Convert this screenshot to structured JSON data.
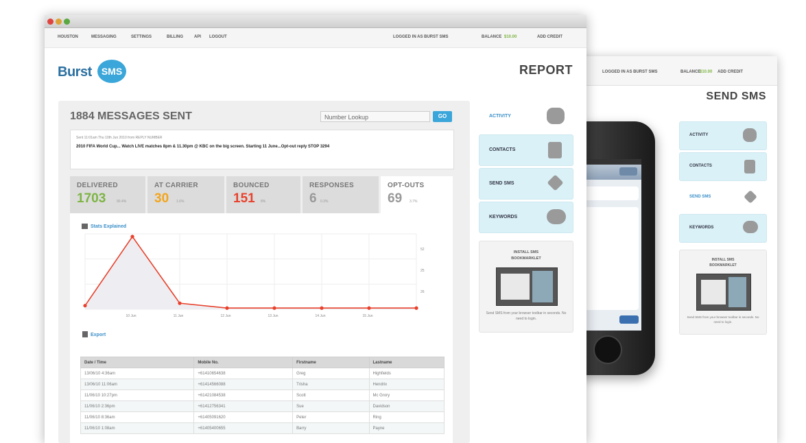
{
  "front_window": {
    "menu": [
      "HOUSTON",
      "MESSAGING",
      "SETTINGS",
      "BILLING",
      "API",
      "LOGOUT"
    ],
    "logged_in": "LOGGED IN AS BURST SMS",
    "balance_label": "BALANCE",
    "balance_value": "$10.00",
    "add_credit": "ADD CREDIT",
    "logo_text": "Burst",
    "logo_badge": "SMS",
    "page_title": "REPORT",
    "messages_sent": "1884 MESSAGES SENT",
    "lookup_placeholder": "Number Lookup",
    "go_label": "GO",
    "message_meta": "Sent 11:01am Thu 10th Jun 2010 from REPLY NUMBER",
    "message_text": "2010 FIFA World Cup... Watch LIVE matches 8pm & 11.30pm @ KBC on the big screen. Starting 11 June...Opt-out reply STOP 3294",
    "stats": [
      {
        "label": "DELIVERED",
        "value": "1703",
        "pct": "90.4%",
        "color": "#7db443"
      },
      {
        "label": "AT CARRIER",
        "value": "30",
        "pct": "1.6%",
        "color": "#f3a51b"
      },
      {
        "label": "BOUNCED",
        "value": "151",
        "pct": "8%",
        "color": "#e8412c"
      },
      {
        "label": "RESPONSES",
        "value": "6",
        "pct": "0.3%",
        "color": "#999999"
      },
      {
        "label": "OPT-OUTS",
        "value": "69",
        "pct": "3.7%",
        "color": "#999999"
      }
    ],
    "stats_link": "Stats Explained",
    "export_link": "Export",
    "table": {
      "headers": [
        "Date / Time",
        "Mobile No.",
        "Firstname",
        "Lastname"
      ],
      "rows": [
        [
          "13/06/10 4:36am",
          "+61410654638",
          "Greg",
          "Highfields"
        ],
        [
          "13/06/10 11:06am",
          "+61414566088",
          "Trisha",
          "Hendrix"
        ],
        [
          "11/06/10 10:27pm",
          "+61421084538",
          "Scott",
          "Mc Grory"
        ],
        [
          "11/06/10 2:36pm",
          "+61412756341",
          "Sue",
          "Davidson"
        ],
        [
          "11/06/10 8:36am",
          "+61405091620",
          "Peter",
          "Ring"
        ],
        [
          "11/06/10 1:08am",
          "+61405400655",
          "Barry",
          "Payne"
        ]
      ]
    },
    "sidebar": [
      "ACTIVITY",
      "CONTACTS",
      "SEND SMS",
      "KEYWORDS"
    ],
    "bookmarklet_title": "INSTALL SMS BOOKMARKLET",
    "bookmarklet_desc": "Send SMS from your browser toolbar in seconds. No need to login."
  },
  "chart_data": {
    "type": "line",
    "x": [
      "",
      "10 Jun",
      "11 Jun",
      "12 Jun",
      "13 Jun",
      "14 Jun",
      "15 Jun",
      ""
    ],
    "values": [
      3,
      60,
      5,
      1,
      1,
      1,
      1,
      1
    ],
    "yticks": [
      "52",
      "25",
      "26"
    ],
    "color": "#e8412c"
  },
  "back_window": {
    "logged_in": "LOGGED IN AS BURST SMS",
    "balance_label": "BALANCE",
    "balance_value": "$10.00",
    "add_credit": "ADD CREDIT",
    "page_title": "SEND SMS",
    "sidebar": [
      "ACTIVITY",
      "CONTACTS",
      "SEND SMS",
      "KEYWORDS"
    ],
    "bookmarklet_title": "INSTALL SMS BOOKMARKLET",
    "bookmarklet_desc": "Send SMS from your browser toolbar in seconds. No need to login."
  }
}
